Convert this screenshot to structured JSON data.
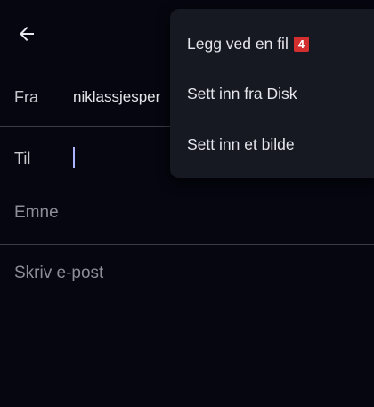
{
  "compose": {
    "from_label": "Fra",
    "from_value": "niklassjesper",
    "to_label": "Til",
    "to_value": "",
    "subject_placeholder": "Emne",
    "body_placeholder": "Skriv e-post"
  },
  "attach_menu": {
    "items": [
      {
        "label": "Legg ved en fil",
        "badge": "4"
      },
      {
        "label": "Sett inn fra Disk"
      },
      {
        "label": "Sett inn et bilde"
      }
    ]
  },
  "icons": {
    "back": "arrow-back-icon"
  },
  "colors": {
    "background": "#05060f",
    "menu_background": "#161822",
    "divider": "#3a3b44",
    "caret": "#aab4ff",
    "badge": "#d32f2f"
  }
}
